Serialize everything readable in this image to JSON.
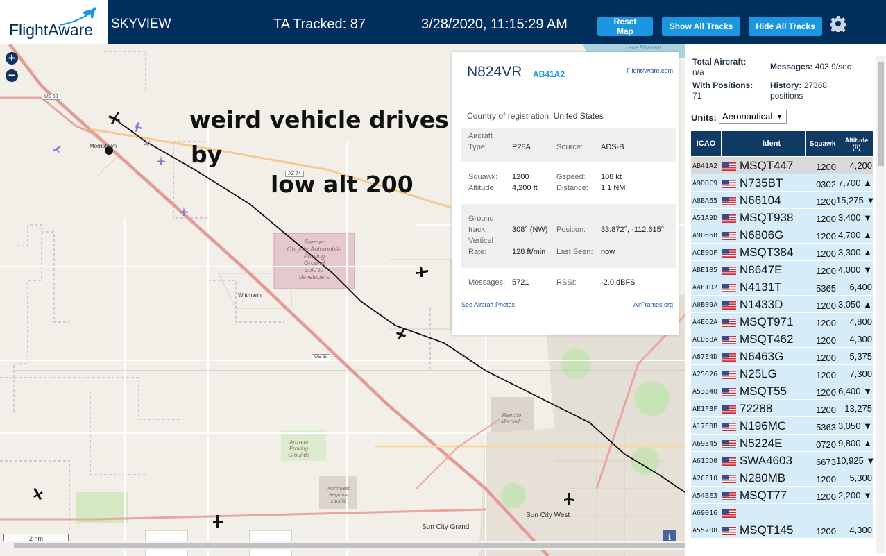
{
  "header": {
    "logo": "FlightAware",
    "app_name": "SKYVIEW",
    "ta_tracked": "TA Tracked: 87",
    "datetime": "3/28/2020, 11:15:29 AM",
    "buttons": {
      "reset": "Reset Map",
      "show_all": "Show All Tracks",
      "hide_all": "Hide All Tracks"
    },
    "settings_icon": "gear-icon"
  },
  "map": {
    "zoom_in": "+",
    "zoom_out": "−",
    "annotations": [
      "weird vehicle drives",
      "by",
      "low alt 200"
    ],
    "shields": [
      "US 60",
      "AZ 74",
      "US 60"
    ],
    "labels": {
      "morristown": "Morristown",
      "wittmann": "Wittmann",
      "proving_ground": [
        "Former",
        "ChryslerAutomobile",
        "Proving",
        "Ground",
        "sold to",
        "developers"
      ],
      "arizona_proving": [
        "Arizona",
        "Proving",
        "Grounds"
      ],
      "rancho_mercado": [
        "Rancho",
        "Mercado"
      ],
      "landfill": [
        "Northwest",
        "Regional",
        "Landfill"
      ],
      "sun_city_west": "Sun City West",
      "sun_city_grand": "Sun City Grand",
      "lake_pleasant": "Lake Pleasant"
    },
    "scale": "2 nm",
    "info": "i"
  },
  "popup": {
    "ident": "N824VR",
    "icao": "AB41A2",
    "fa_link": "FlightAware.com",
    "country_label": "Country of registration:",
    "country": "United States",
    "aircraft_type_label": [
      "Aircraft",
      "Type:"
    ],
    "aircraft_type": "P28A",
    "source_label": "Source:",
    "source": "ADS-B",
    "squawk_label": "Squawk:",
    "squawk": "1200",
    "gspeed_label": "Gspeed:",
    "gspeed": "108 kt",
    "altitude_label": "Altitude:",
    "altitude": "4,200 ft",
    "distance_label": "Distance:",
    "distance": "1.1 NM",
    "track_label": [
      "Ground",
      "track:"
    ],
    "track": "308° (NW)",
    "position_label": "Position:",
    "position": "33.872°, -112.615°",
    "vrate_label": [
      "Vertical",
      "Rate:"
    ],
    "vrate": "128 ft/min",
    "last_seen_label": "Last Seen:",
    "last_seen": "now",
    "messages_label": "Messages:",
    "messages": "5721",
    "rssi_label": "RSSI:",
    "rssi": "-2.0 dBFS",
    "photos_link": "See Aircraft Photos",
    "airframes_link": "AirFrames.org"
  },
  "panel": {
    "total_aircraft_label": "Total Aircraft:",
    "total_aircraft": "n/a",
    "messages_label": "Messages:",
    "messages": "403.9/sec",
    "with_positions_label": "With Positions:",
    "with_positions": "71",
    "history_label": "History:",
    "history": "27368",
    "history_unit": "positions",
    "units_label": "Units:",
    "units_value": "Aeronautical",
    "columns": [
      "ICAO",
      "Ident",
      "Squawk",
      "Altitude (ft)"
    ],
    "rows": [
      {
        "icao": "AB41A2",
        "ident": "MSQT447",
        "squawk": "1200",
        "alt": "4,200",
        "trend": ""
      },
      {
        "icao": "A9DDC9",
        "ident": "N735BT",
        "squawk": "0302",
        "alt": "7,700",
        "trend": "▲"
      },
      {
        "icao": "A8BA65",
        "ident": "N66104",
        "squawk": "1200",
        "alt": "15,275",
        "trend": "▼"
      },
      {
        "icao": "A51A9D",
        "ident": "MSQT938",
        "squawk": "1200",
        "alt": "3,400",
        "trend": "▼"
      },
      {
        "icao": "A90668",
        "ident": "N6806G",
        "squawk": "1200",
        "alt": "4,700",
        "trend": "▲"
      },
      {
        "icao": "ACE0DF",
        "ident": "MSQT384",
        "squawk": "1200",
        "alt": "3,300",
        "trend": "▲"
      },
      {
        "icao": "ABE105",
        "ident": "N8647E",
        "squawk": "1200",
        "alt": "4,000",
        "trend": "▼"
      },
      {
        "icao": "A4E1D2",
        "ident": "N4131T",
        "squawk": "5365",
        "alt": "6,400",
        "trend": ""
      },
      {
        "icao": "A0B09A",
        "ident": "N1433D",
        "squawk": "1200",
        "alt": "3,050",
        "trend": "▲"
      },
      {
        "icao": "A4E62A",
        "ident": "MSQT971",
        "squawk": "1200",
        "alt": "4,800",
        "trend": ""
      },
      {
        "icao": "ACD5BA",
        "ident": "MSQT462",
        "squawk": "1200",
        "alt": "4,300",
        "trend": ""
      },
      {
        "icao": "A87E4D",
        "ident": "N6463G",
        "squawk": "1200",
        "alt": "5,375",
        "trend": ""
      },
      {
        "icao": "A25626",
        "ident": "N25LG",
        "squawk": "1200",
        "alt": "7,300",
        "trend": ""
      },
      {
        "icao": "A53340",
        "ident": "MSQT55",
        "squawk": "1200",
        "alt": "6,400",
        "trend": "▼"
      },
      {
        "icao": "AE1F8F",
        "ident": "72288",
        "squawk": "1200",
        "alt": "13,275",
        "trend": ""
      },
      {
        "icao": "A17F8B",
        "ident": "N196MC",
        "squawk": "5363",
        "alt": "3,050",
        "trend": "▼"
      },
      {
        "icao": "A69345",
        "ident": "N5224E",
        "squawk": "0720",
        "alt": "9,800",
        "trend": "▲"
      },
      {
        "icao": "A615D0",
        "ident": "SWA4603",
        "squawk": "6673",
        "alt": "10,925",
        "trend": "▼"
      },
      {
        "icao": "A2CF10",
        "ident": "N280MB",
        "squawk": "1200",
        "alt": "5,300",
        "trend": ""
      },
      {
        "icao": "A54BE3",
        "ident": "MSQT77",
        "squawk": "1200",
        "alt": "2,200",
        "trend": "▼"
      },
      {
        "icao": "A69016",
        "ident": "",
        "squawk": "",
        "alt": "",
        "trend": ""
      },
      {
        "icao": "A55708",
        "ident": "MSQT145",
        "squawk": "1200",
        "alt": "4,300",
        "trend": ""
      }
    ]
  }
}
